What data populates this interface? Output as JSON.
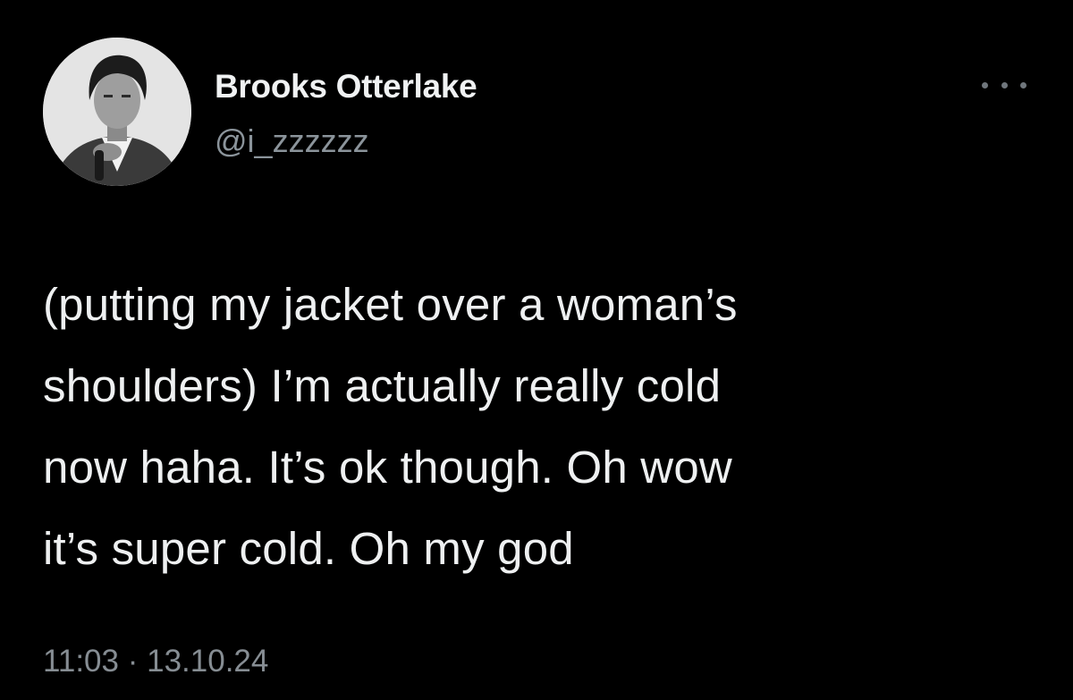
{
  "tweet": {
    "author": {
      "display_name": "Brooks Otterlake",
      "handle": "@i_zzzzzz",
      "avatar_icon": "profile-photo-avatar"
    },
    "more_icon": "more-options-icon",
    "text_lines": [
      "(putting my jacket over a woman’s",
      "shoulders) I’m actually really cold",
      "now haha. It’s ok though. Oh wow",
      "it’s super cold. Oh my god"
    ],
    "time": "11:03",
    "separator": " · ",
    "date": "13.10.24"
  },
  "colors": {
    "background": "#000000",
    "text": "#eef0f1",
    "muted": "#868d93"
  }
}
